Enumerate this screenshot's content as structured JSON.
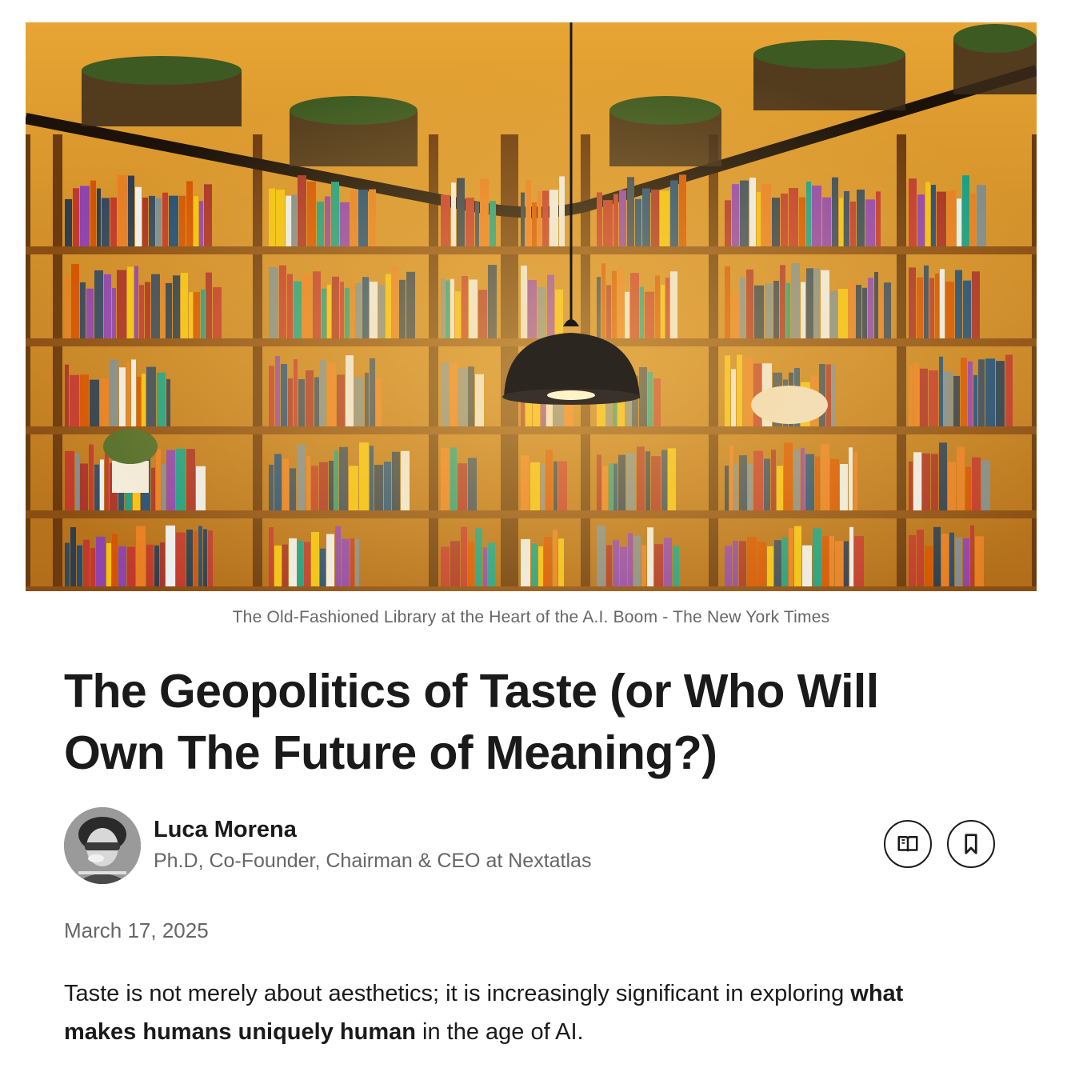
{
  "hero_image": {
    "description_icon": "library-bookshelves-image",
    "colors": {
      "wood": "#b8741c",
      "glow": "#f0b030",
      "dark": "#2a1608"
    }
  },
  "caption": "The Old-Fashioned Library at the Heart of the A.I. Boom - The New York Times",
  "article": {
    "title": "The Geopolitics of Taste (or Who Will Own The Future of Meaning?)",
    "date": "March 17, 2025",
    "body": {
      "part1": "Taste is not merely about aesthetics; it is increasingly significant in exploring ",
      "bold": "what makes humans uniquely human",
      "part2": " in the age of AI."
    }
  },
  "author": {
    "name": "Luca Morena",
    "headline": "Ph.D, Co-Founder, Chairman & CEO at Nextatlas",
    "avatar_icon": "author-avatar"
  },
  "actions": {
    "read_icon": "open-book-icon",
    "save_icon": "bookmark-icon",
    "border_color": "#1a1a1a"
  }
}
